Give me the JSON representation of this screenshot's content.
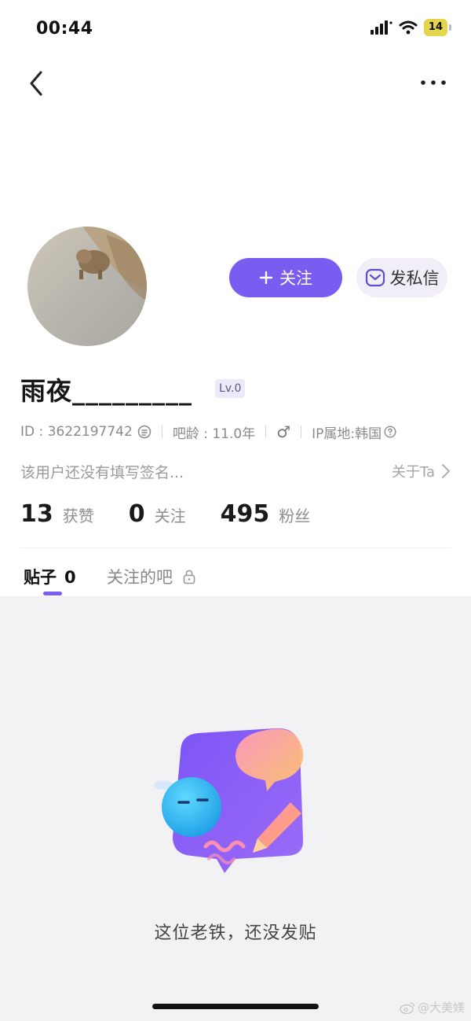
{
  "status_bar": {
    "time": "00:44",
    "battery": "14"
  },
  "profile": {
    "follow_button": "关注",
    "message_button": "发私信",
    "username": "雨夜_________",
    "level": "Lv.0",
    "id_text": "ID : 3622197742",
    "bar_age": "吧龄 : 11.0年",
    "gender_symbol": "♂",
    "ip_location": "IP属地:韩国",
    "bio": "该用户还没有填写签名...",
    "about_link": "关于Ta"
  },
  "stats": [
    {
      "value": "13",
      "label": "获赞"
    },
    {
      "value": "0",
      "label": "关注"
    },
    {
      "value": "495",
      "label": "粉丝"
    }
  ],
  "tabs": {
    "posts_label": "贴子",
    "posts_count": "0",
    "followed_bars_label": "关注的吧"
  },
  "empty_state": {
    "message": "这位老铁，还没发贴"
  },
  "watermark": "@大美媄",
  "icons": {
    "back": "chevron-left-icon",
    "more": "more-dots-icon",
    "plus": "plus-icon",
    "mail": "mail-icon",
    "copy": "copy-icon",
    "help": "question-circle-icon",
    "chevron_right": "chevron-right-icon",
    "lock": "lock-icon"
  },
  "colors": {
    "accent": "#7b5cf0",
    "background_gray": "#f2f2f4",
    "badge_bg": "#ece9fb"
  }
}
